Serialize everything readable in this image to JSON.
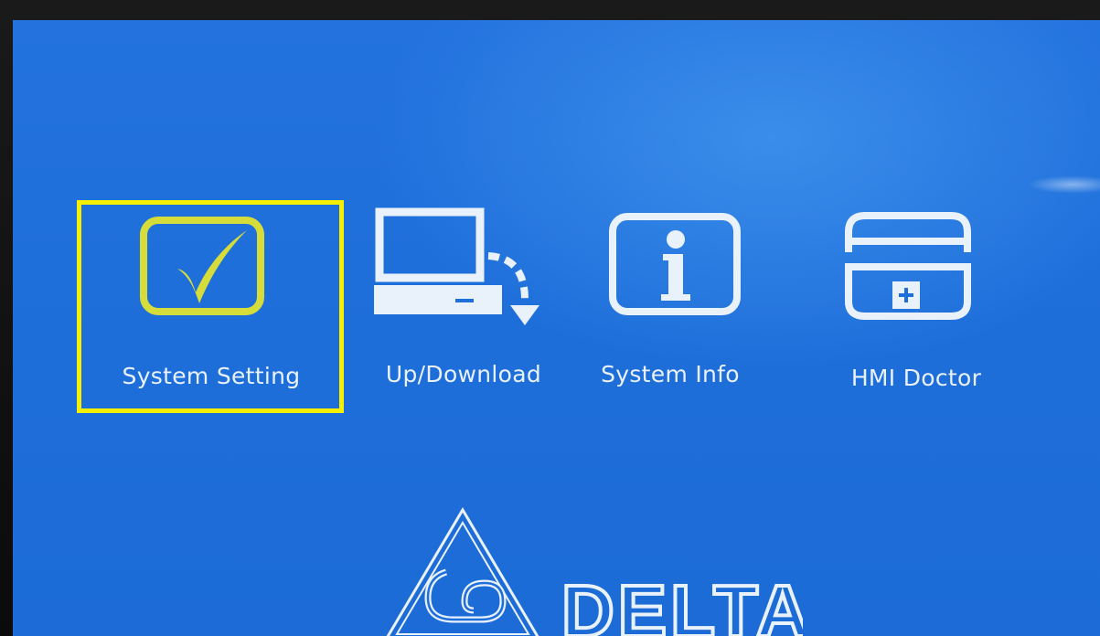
{
  "menu": {
    "items": [
      {
        "label": "System Setting",
        "icon": "checkmark-icon",
        "selected": true
      },
      {
        "label": "Up/Download",
        "icon": "computer-download-icon",
        "selected": false
      },
      {
        "label": "System Info",
        "icon": "info-icon",
        "selected": false
      },
      {
        "label": "HMI Doctor",
        "icon": "medical-kit-icon",
        "selected": false
      }
    ]
  },
  "brand": {
    "name": "DELTA",
    "logo_icon": "delta-triangle-logo"
  },
  "colors": {
    "screen_background": "#1f6fdb",
    "selection_frame": "#f6f000",
    "selected_label": "#d6dc3a",
    "icon_stroke": "#e9f1fb"
  }
}
